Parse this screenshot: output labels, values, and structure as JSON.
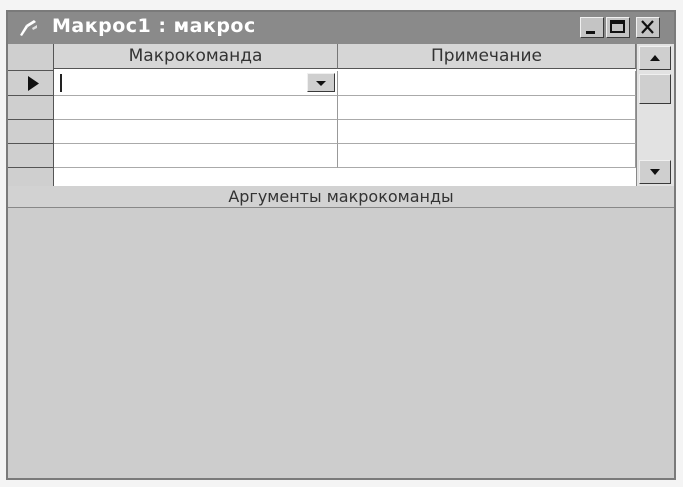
{
  "window": {
    "title": "Макрос1 : макрос"
  },
  "grid": {
    "columns": [
      "Макрокоманда",
      "Примечание"
    ],
    "rows": [
      {
        "action": "",
        "comment": ""
      },
      {
        "action": "",
        "comment": ""
      },
      {
        "action": "",
        "comment": ""
      },
      {
        "action": "",
        "comment": ""
      }
    ]
  },
  "arguments_panel": {
    "title": "Аргументы макрокоманды"
  },
  "icons": [
    "macro-icon",
    "minimize-icon",
    "maximize-icon",
    "close-icon",
    "current-row-arrow-icon",
    "dropdown-arrow-icon",
    "scroll-up-icon",
    "scroll-down-icon"
  ]
}
